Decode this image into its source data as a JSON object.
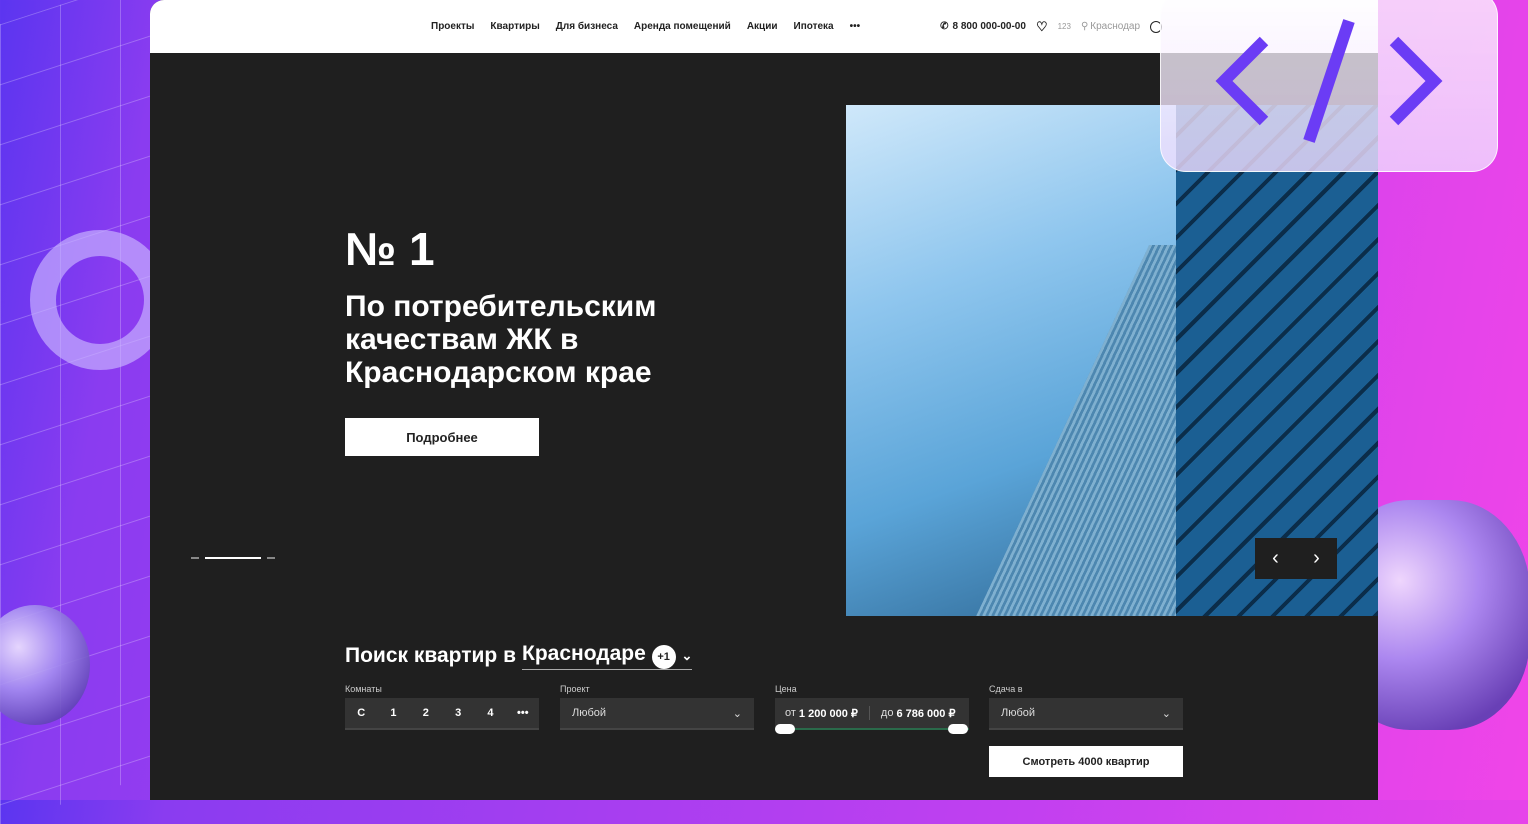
{
  "header": {
    "nav": [
      "Проекты",
      "Квартиры",
      "Для бизнеса",
      "Аренда помещений",
      "Акции",
      "Ипотека"
    ],
    "more": "•••",
    "phone": "8 800 000-00-00",
    "favorites_count": "123",
    "city": "Краснодар"
  },
  "hero": {
    "title": "№ 1",
    "subtitle": "По потребительским качествам ЖК в Краснодарском крае",
    "button": "Подробнее",
    "slide_index": 2,
    "slide_count": 3
  },
  "search": {
    "title": "Поиск квартир в",
    "city": "Краснодаре",
    "badge": "+1",
    "rooms_label": "Комнаты",
    "rooms": [
      "С",
      "1",
      "2",
      "3",
      "4",
      "•••"
    ],
    "project_label": "Проект",
    "project_value": "Любой",
    "price_label": "Цена",
    "price_from_prefix": "от",
    "price_from": "1 200 000 ₽",
    "price_to_prefix": "до",
    "price_to": "6 786 000 ₽",
    "delivery_label": "Сдача в",
    "delivery_value": "Любой",
    "submit": "Смотреть 4000 квартир"
  },
  "colors": {
    "accent": "#6b3cf5",
    "dark": "#1f1f1f"
  }
}
